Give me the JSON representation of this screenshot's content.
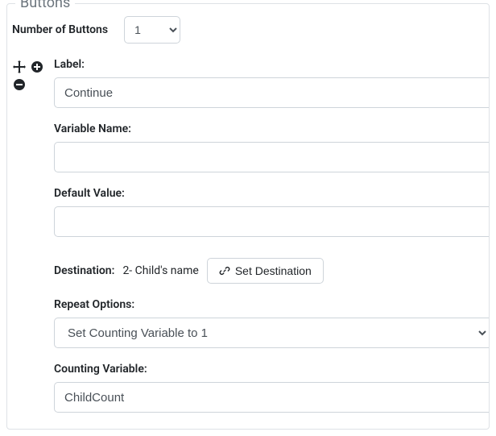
{
  "panel": {
    "title": "Buttons",
    "numberOfButtonsLabel": "Number of Buttons",
    "numberOfButtonsValue": "1"
  },
  "button": {
    "labelLabel": "Label:",
    "labelValue": "Continue",
    "variableNameLabel": "Variable Name:",
    "variableNameValue": "",
    "defaultValueLabel": "Default Value:",
    "defaultValueValue": "",
    "destinationLabel": "Destination:",
    "destinationValue": "2- Child's name",
    "setDestinationLabel": "Set Destination",
    "repeatOptionsLabel": "Repeat Options:",
    "repeatOptionsValue": "Set Counting Variable to 1",
    "countingVariableLabel": "Counting Variable:",
    "countingVariableValue": "ChildCount"
  }
}
